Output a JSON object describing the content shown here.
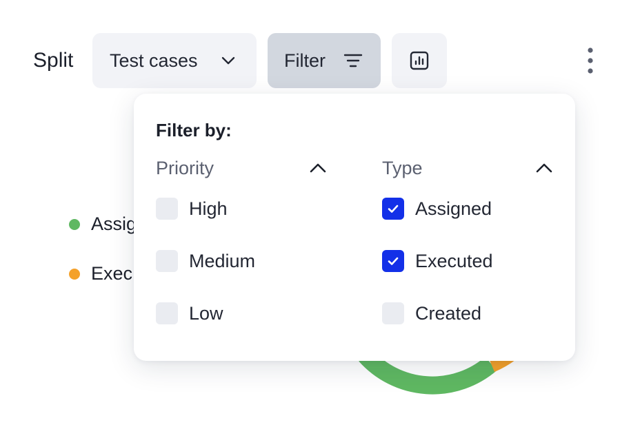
{
  "toolbar": {
    "split_label": "Split",
    "test_cases_label": "Test cases",
    "filter_label": "Filter",
    "chart_icon": "bar-chart-icon",
    "more_icon": "more-vertical-icon"
  },
  "chart": {
    "legend": [
      {
        "label": "Assig",
        "color": "#5fb862"
      },
      {
        "label": "Exec",
        "color": "#f4a12a"
      }
    ]
  },
  "filter_popover": {
    "title": "Filter by:",
    "priority": {
      "label": "Priority",
      "options": [
        {
          "label": "High",
          "checked": false
        },
        {
          "label": "Medium",
          "checked": false
        },
        {
          "label": "Low",
          "checked": false
        }
      ]
    },
    "type": {
      "label": "Type",
      "options": [
        {
          "label": "Assigned",
          "checked": true
        },
        {
          "label": "Executed",
          "checked": true
        },
        {
          "label": "Created",
          "checked": false
        }
      ]
    }
  },
  "colors": {
    "accent": "#1330e8",
    "assigned": "#5fb862",
    "executed": "#f4a12a",
    "button_bg": "#f2f3f7",
    "button_active_bg": "#d2d7df"
  }
}
